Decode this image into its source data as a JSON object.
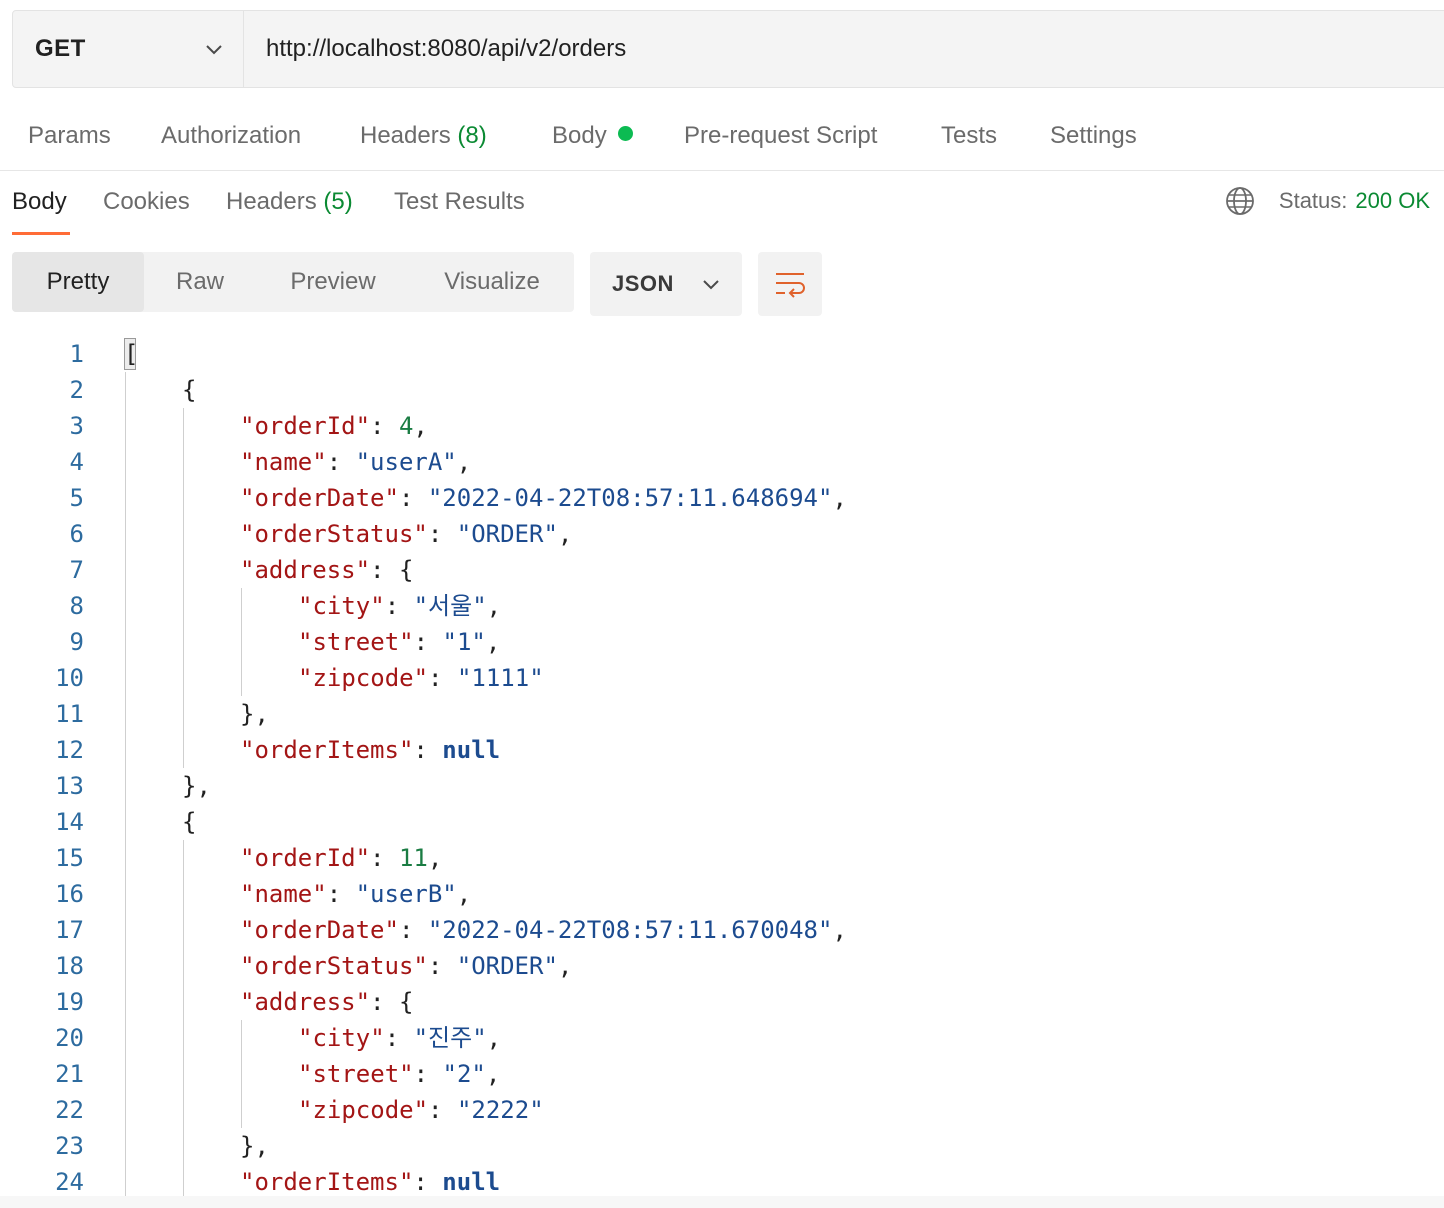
{
  "request": {
    "method": "GET",
    "url": "http://localhost:8080/api/v2/orders"
  },
  "request_tabs": {
    "params": "Params",
    "authorization": "Authorization",
    "headers_label": "Headers",
    "headers_count": "(8)",
    "body": "Body",
    "pre_request": "Pre-request Script",
    "tests": "Tests",
    "settings": "Settings"
  },
  "response_tabs": {
    "body": "Body",
    "cookies": "Cookies",
    "headers_label": "Headers",
    "headers_count": "(5)",
    "test_results": "Test Results"
  },
  "status": {
    "label": "Status:",
    "value": "200 OK"
  },
  "view_modes": {
    "pretty": "Pretty",
    "raw": "Raw",
    "preview": "Preview",
    "visualize": "Visualize"
  },
  "format": "JSON",
  "colors": {
    "accent": "#ff6c37",
    "status_ok": "#0b8a33",
    "dot": "#0cbb52"
  },
  "code_lines": [
    {
      "n": "1",
      "indent": 0,
      "tokens": [
        [
          "p",
          "["
        ]
      ]
    },
    {
      "n": "2",
      "indent": 1,
      "tokens": [
        [
          "p",
          "{"
        ]
      ]
    },
    {
      "n": "3",
      "indent": 2,
      "tokens": [
        [
          "k",
          "\"orderId\""
        ],
        [
          "p",
          ": "
        ],
        [
          "num",
          "4"
        ],
        [
          "p",
          ","
        ]
      ]
    },
    {
      "n": "4",
      "indent": 2,
      "tokens": [
        [
          "k",
          "\"name\""
        ],
        [
          "p",
          ": "
        ],
        [
          "s",
          "\"userA\""
        ],
        [
          "p",
          ","
        ]
      ]
    },
    {
      "n": "5",
      "indent": 2,
      "tokens": [
        [
          "k",
          "\"orderDate\""
        ],
        [
          "p",
          ": "
        ],
        [
          "s",
          "\"2022-04-22T08:57:11.648694\""
        ],
        [
          "p",
          ","
        ]
      ]
    },
    {
      "n": "6",
      "indent": 2,
      "tokens": [
        [
          "k",
          "\"orderStatus\""
        ],
        [
          "p",
          ": "
        ],
        [
          "s",
          "\"ORDER\""
        ],
        [
          "p",
          ","
        ]
      ]
    },
    {
      "n": "7",
      "indent": 2,
      "tokens": [
        [
          "k",
          "\"address\""
        ],
        [
          "p",
          ": {"
        ]
      ]
    },
    {
      "n": "8",
      "indent": 3,
      "tokens": [
        [
          "k",
          "\"city\""
        ],
        [
          "p",
          ": "
        ],
        [
          "s",
          "\"서울\""
        ],
        [
          "p",
          ","
        ]
      ]
    },
    {
      "n": "9",
      "indent": 3,
      "tokens": [
        [
          "k",
          "\"street\""
        ],
        [
          "p",
          ": "
        ],
        [
          "s",
          "\"1\""
        ],
        [
          "p",
          ","
        ]
      ]
    },
    {
      "n": "10",
      "indent": 3,
      "tokens": [
        [
          "k",
          "\"zipcode\""
        ],
        [
          "p",
          ": "
        ],
        [
          "s",
          "\"1111\""
        ]
      ]
    },
    {
      "n": "11",
      "indent": 2,
      "tokens": [
        [
          "p",
          "},"
        ]
      ]
    },
    {
      "n": "12",
      "indent": 2,
      "tokens": [
        [
          "k",
          "\"orderItems\""
        ],
        [
          "p",
          ": "
        ],
        [
          "null",
          "null"
        ]
      ]
    },
    {
      "n": "13",
      "indent": 1,
      "tokens": [
        [
          "p",
          "},"
        ]
      ]
    },
    {
      "n": "14",
      "indent": 1,
      "tokens": [
        [
          "p",
          "{"
        ]
      ]
    },
    {
      "n": "15",
      "indent": 2,
      "tokens": [
        [
          "k",
          "\"orderId\""
        ],
        [
          "p",
          ": "
        ],
        [
          "num",
          "11"
        ],
        [
          "p",
          ","
        ]
      ]
    },
    {
      "n": "16",
      "indent": 2,
      "tokens": [
        [
          "k",
          "\"name\""
        ],
        [
          "p",
          ": "
        ],
        [
          "s",
          "\"userB\""
        ],
        [
          "p",
          ","
        ]
      ]
    },
    {
      "n": "17",
      "indent": 2,
      "tokens": [
        [
          "k",
          "\"orderDate\""
        ],
        [
          "p",
          ": "
        ],
        [
          "s",
          "\"2022-04-22T08:57:11.670048\""
        ],
        [
          "p",
          ","
        ]
      ]
    },
    {
      "n": "18",
      "indent": 2,
      "tokens": [
        [
          "k",
          "\"orderStatus\""
        ],
        [
          "p",
          ": "
        ],
        [
          "s",
          "\"ORDER\""
        ],
        [
          "p",
          ","
        ]
      ]
    },
    {
      "n": "19",
      "indent": 2,
      "tokens": [
        [
          "k",
          "\"address\""
        ],
        [
          "p",
          ": {"
        ]
      ]
    },
    {
      "n": "20",
      "indent": 3,
      "tokens": [
        [
          "k",
          "\"city\""
        ],
        [
          "p",
          ": "
        ],
        [
          "s",
          "\"진주\""
        ],
        [
          "p",
          ","
        ]
      ]
    },
    {
      "n": "21",
      "indent": 3,
      "tokens": [
        [
          "k",
          "\"street\""
        ],
        [
          "p",
          ": "
        ],
        [
          "s",
          "\"2\""
        ],
        [
          "p",
          ","
        ]
      ]
    },
    {
      "n": "22",
      "indent": 3,
      "tokens": [
        [
          "k",
          "\"zipcode\""
        ],
        [
          "p",
          ": "
        ],
        [
          "s",
          "\"2222\""
        ]
      ]
    },
    {
      "n": "23",
      "indent": 2,
      "tokens": [
        [
          "p",
          "},"
        ]
      ]
    },
    {
      "n": "24",
      "indent": 2,
      "tokens": [
        [
          "k",
          "\"orderItems\""
        ],
        [
          "p",
          ": "
        ],
        [
          "null",
          "null"
        ]
      ]
    }
  ]
}
